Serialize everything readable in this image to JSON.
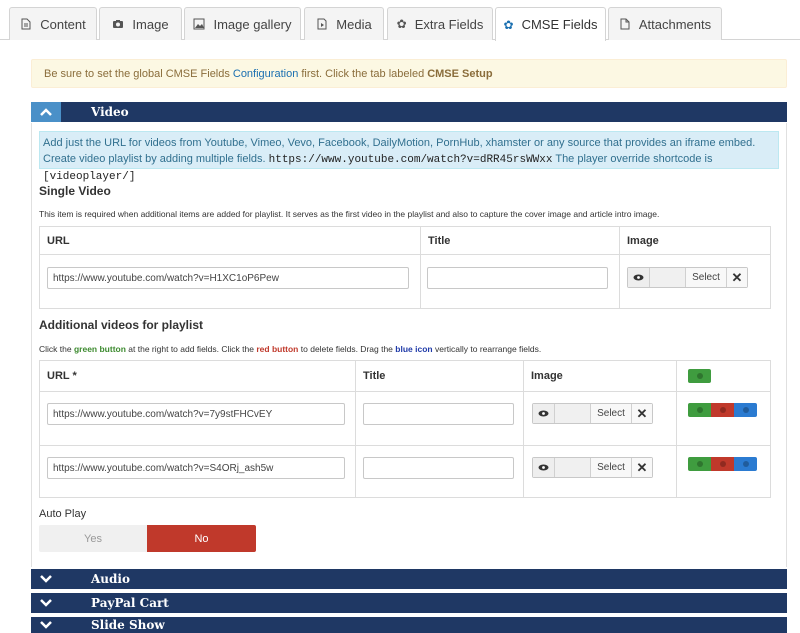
{
  "tabs": [
    {
      "label": "Content",
      "icon": "document-icon"
    },
    {
      "label": "Image",
      "icon": "camera-icon"
    },
    {
      "label": "Image gallery",
      "icon": "image-icon"
    },
    {
      "label": "Media",
      "icon": "media-icon"
    },
    {
      "label": "Extra Fields",
      "icon": "gear-icon"
    },
    {
      "label": "CMSE Fields",
      "icon": "gear-icon",
      "active": true
    },
    {
      "label": "Attachments",
      "icon": "file-icon"
    }
  ],
  "notice": {
    "pre": "Be sure to set the global CMSE Fields",
    "link": "Configuration",
    "mid": "first. Click the tab labeled",
    "bold": "CMSE Setup"
  },
  "sections": {
    "video": "Video",
    "audio": "Audio",
    "paypal": "PayPal Cart",
    "slideshow": "Slide Show"
  },
  "info": {
    "text1": "Add just the URL for videos from Youtube, Vimeo, Vevo, Facebook, DailyMotion, PornHub, xhamster or any source that provides an iframe embed. Create video playlist by adding multiple fields.",
    "code1": "https://www.youtube.com/watch?v=dRR45rsWWxx",
    "text2": "The player override shortcode is",
    "code2": "[videoplayer/]"
  },
  "single": {
    "title": "Single Video",
    "desc": "This item is required when additional items are added for playlist. It serves as the first video in the playlist and also to capture the cover image and article intro image.",
    "headers": {
      "url": "URL",
      "title": "Title",
      "image": "Image"
    },
    "url": "https://www.youtube.com/watch?v=H1XC1oP6Pew",
    "title_value": "",
    "select": "Select"
  },
  "playlist": {
    "title": "Additional videos for playlist",
    "desc_pre": "Click the",
    "desc_green": "green button",
    "desc_mid1": "at the right to add fields. Click the",
    "desc_red": "red button",
    "desc_mid2": "to delete fields. Drag the",
    "desc_blue": "blue icon",
    "desc_post": "vertically to rearrange fields.",
    "headers": {
      "url": "URL *",
      "title": "Title",
      "image": "Image"
    },
    "rows": [
      {
        "url": "https://www.youtube.com/watch?v=7y9stFHCvEY",
        "title": "",
        "select": "Select"
      },
      {
        "url": "https://www.youtube.com/watch?v=S4ORj_ash5w",
        "title": "",
        "select": "Select"
      }
    ]
  },
  "autoplay": {
    "label": "Auto Play",
    "yes": "Yes",
    "no": "No",
    "selected": "No"
  },
  "colors": {
    "accent_dark": "#1f3864",
    "accent_light": "#4a90c8",
    "add": "#3f9c3f",
    "delete": "#c0392b",
    "move": "#2b7bd1"
  }
}
